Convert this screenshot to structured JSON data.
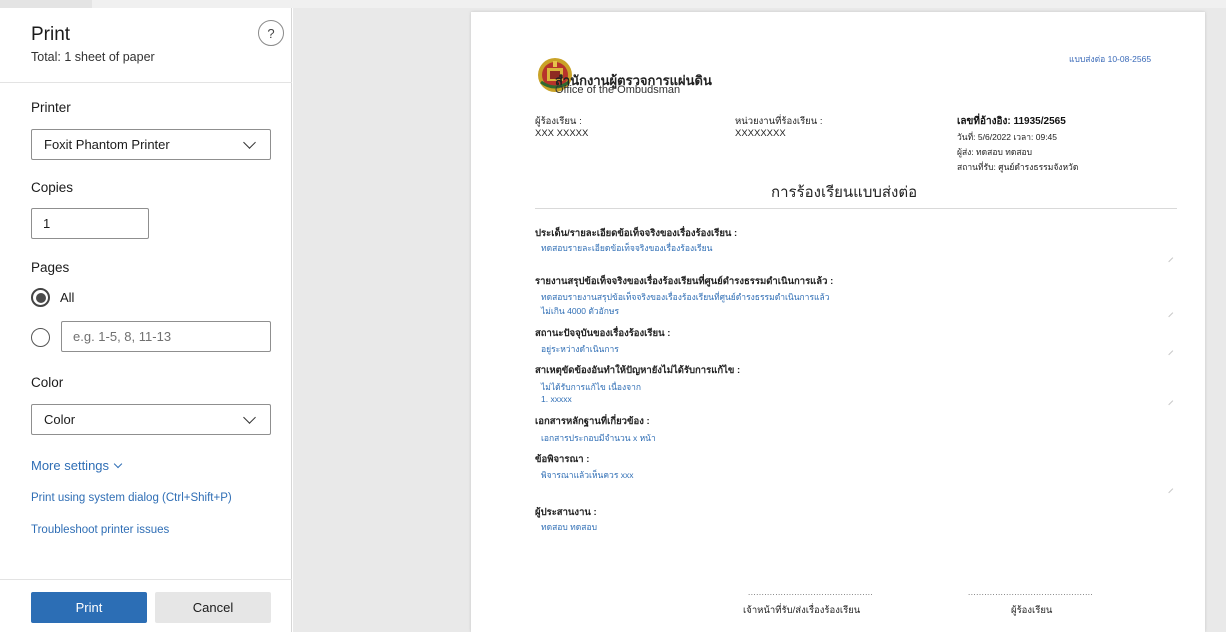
{
  "print_panel": {
    "title": "Print",
    "subtitle": "Total: 1 sheet of paper",
    "help_label": "?",
    "printer_label": "Printer",
    "printer_value": "Foxit Phantom Printer",
    "copies_label": "Copies",
    "copies_value": "1",
    "pages_label": "Pages",
    "pages_all_label": "All",
    "pages_selected": "All",
    "pages_range_placeholder": "e.g. 1-5, 8, 11-13",
    "color_label": "Color",
    "color_value": "Color",
    "more_settings": "More settings",
    "system_dialog_link": "Print using system dialog (Ctrl+Shift+P)",
    "troubleshoot_link": "Troubleshoot printer issues",
    "print_button": "Print",
    "cancel_button": "Cancel"
  },
  "document": {
    "ref_top": "แบบส่งต่อ 10-08-2565",
    "org_name_th": "สำนักงานผู้ตรวจการแผ่นดิน",
    "org_name_en": "Office of the Ombudsman",
    "complainant_label": "ผู้ร้องเรียน :",
    "complainant_value": "XXX  XXXXX",
    "agency_label": "หน่วยงานที่ร้องเรียน :",
    "agency_value": "XXXXXXXX",
    "ref_no": "เลขที่อ้างอิง: 11935/2565",
    "date_line": "วันที่: 5/6/2022 เวลา: 09:45",
    "sender_line": "ผู้ส่ง: ทดสอบ ทดสอบ",
    "location_line": "สถานที่รับ: ศูนย์ดำรงธรรมจังหวัด",
    "doc_title": "การร้องเรียนแบบส่งต่อ",
    "sections": [
      {
        "label": "ประเด็น/รายละเอียดข้อเท็จจริงของเรื่องร้องเรียน :",
        "lines": [
          "ทดสอบรายละเอียดข้อเท็จจริงของเรื่องร้องเรียน"
        ]
      },
      {
        "label": "รายงานสรุปข้อเท็จจริงของเรื่องร้องเรียนที่ศูนย์ดำรงธรรมดำเนินการแล้ว :",
        "lines": [
          "ทดสอบรายงานสรุปข้อเท็จจริงของเรื่องร้องเรียนที่ศูนย์ดำรงธรรมดำเนินการแล้ว",
          "ไม่เกิน 4000 ตัวอักษร"
        ]
      },
      {
        "label": "สถานะปัจจุบันของเรื่องร้องเรียน :",
        "lines": [
          "อยู่ระหว่างดำเนินการ"
        ]
      },
      {
        "label": "สาเหตุขัดข้องอันทำให้ปัญหายังไม่ได้รับการแก้ไข :",
        "lines": [
          "ไม่ได้รับการแก้ไข เนื่องจาก",
          "1. xxxxx"
        ]
      },
      {
        "label": "เอกสารหลักฐานที่เกี่ยวข้อง :",
        "lines": [
          "เอกสารประกอบมีจำนวน x หน้า"
        ]
      },
      {
        "label": "ข้อพิจารณา :",
        "lines": [
          "พิจารณาแล้วเห็นควร xxx"
        ]
      },
      {
        "label": "ผู้ประสานงาน :",
        "lines": [
          "ทดสอบ ทดสอบ"
        ]
      }
    ],
    "sig_dots": "..............................................",
    "sig_officer": "เจ้าหน้าที่รับ/ส่งเรื่องร้องเรียน",
    "sig_complainant": "ผู้ร้องเรียน"
  }
}
